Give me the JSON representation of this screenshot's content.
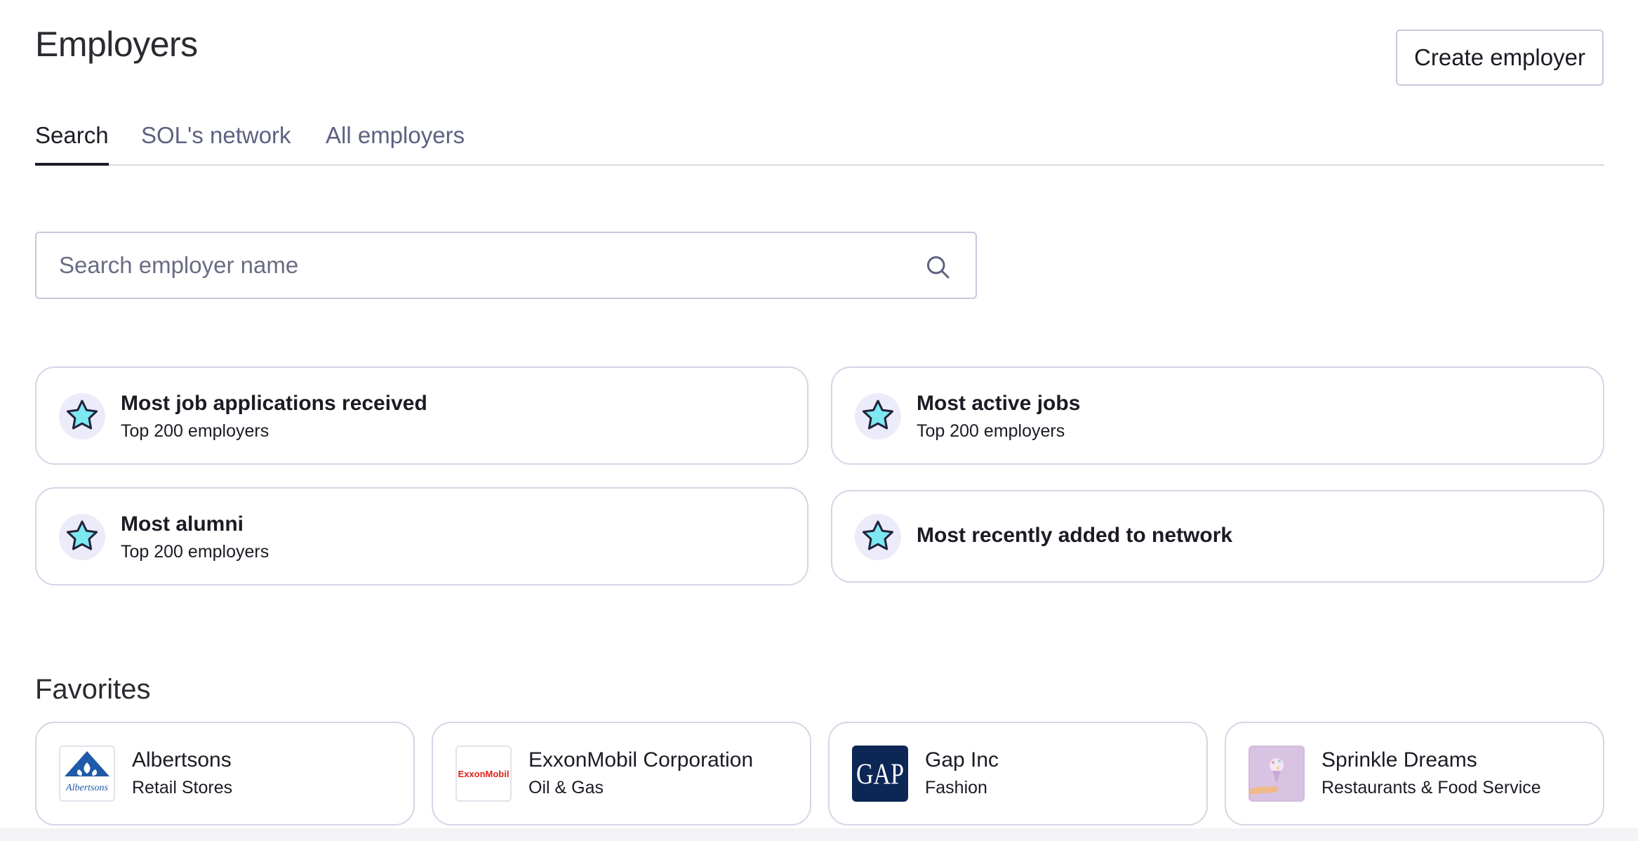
{
  "header": {
    "title": "Employers",
    "create_button_label": "Create employer"
  },
  "tabs": [
    {
      "label": "Search",
      "active": true
    },
    {
      "label": "SOL's network",
      "active": false
    },
    {
      "label": "All employers",
      "active": false
    }
  ],
  "search": {
    "placeholder": "Search employer name",
    "value": "",
    "icon": "search-icon"
  },
  "stat_cards": [
    {
      "title": "Most job applications received",
      "subtitle": "Top 200 employers",
      "icon": "star-icon"
    },
    {
      "title": "Most active jobs",
      "subtitle": "Top 200 employers",
      "icon": "star-icon"
    },
    {
      "title": "Most alumni",
      "subtitle": "Top 200 employers",
      "icon": "star-icon"
    },
    {
      "title": "Most recently added to network",
      "subtitle": "",
      "icon": "star-icon"
    }
  ],
  "favorites": {
    "title": "Favorites",
    "items": [
      {
        "name": "Albertsons",
        "category": "Retail Stores",
        "logo_text": "Albertsons",
        "logo_color": "#1f5aa8"
      },
      {
        "name": "ExxonMobil Corporation",
        "category": "Oil & Gas",
        "logo_text": "ExxonMobil",
        "logo_color": "#e2231a"
      },
      {
        "name": "Gap Inc",
        "category": "Fashion",
        "logo_text": "GAP",
        "logo_color": "#0c2756"
      },
      {
        "name": "Sprinkle Dreams",
        "category": "Restaurants & Food Service",
        "logo_text": "",
        "logo_color": "#d9c3e3"
      }
    ]
  },
  "colors": {
    "star_fill": "#7ee8f2",
    "star_badge_bg": "#ecebfa",
    "border": "#d6d5e6",
    "tab_inactive": "#5e6180"
  }
}
